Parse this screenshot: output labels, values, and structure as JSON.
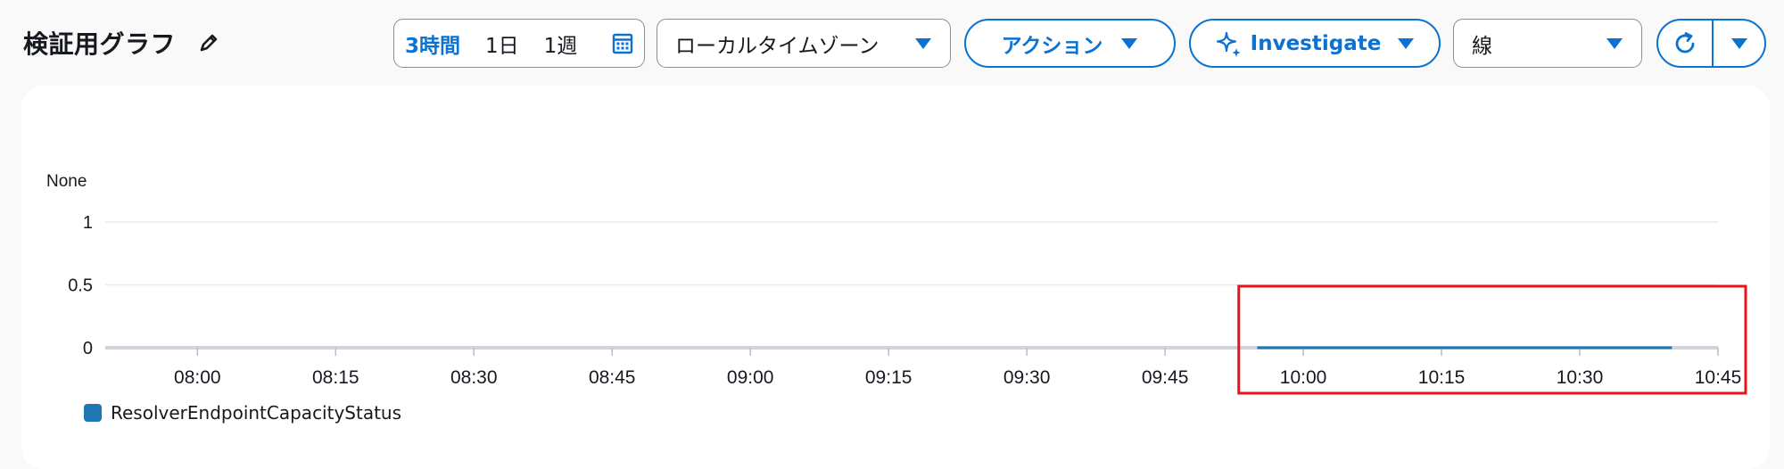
{
  "title": "検証用グラフ",
  "time_range": {
    "options": [
      "3時間",
      "1日",
      "1週"
    ],
    "selected": "3時間"
  },
  "timezone_select": {
    "value": "ローカルタイムゾーン"
  },
  "actions_button": {
    "label": "アクション"
  },
  "investigate_button": {
    "label": "Investigate"
  },
  "statistic_select": {
    "value": "線"
  },
  "colors": {
    "accent": "#0972d3",
    "series": "#1f77b4",
    "highlight": "#e8141d"
  },
  "icons": [
    "edit-pencil-icon",
    "calendar-icon",
    "caret-down-icon",
    "sparkle-icon",
    "refresh-icon"
  ],
  "chart_data": {
    "type": "line",
    "ylabel": "None",
    "yticks": [
      "1",
      "0.5",
      "0"
    ],
    "ylim": [
      0,
      1
    ],
    "xticks": [
      "08:00",
      "08:15",
      "08:30",
      "08:45",
      "09:00",
      "09:15",
      "09:30",
      "09:45",
      "10:00",
      "10:15",
      "10:30",
      "10:45"
    ],
    "xlim": [
      "07:50",
      "10:45"
    ],
    "grid": true,
    "series": [
      {
        "name": "ResolverEndpointCapacityStatus",
        "color": "#1f77b4",
        "x": [
          "09:55",
          "10:40"
        ],
        "y": [
          0,
          0
        ]
      }
    ],
    "highlight_box": {
      "color": "#e8141d",
      "x_range": [
        "09:53",
        "10:48"
      ]
    }
  }
}
